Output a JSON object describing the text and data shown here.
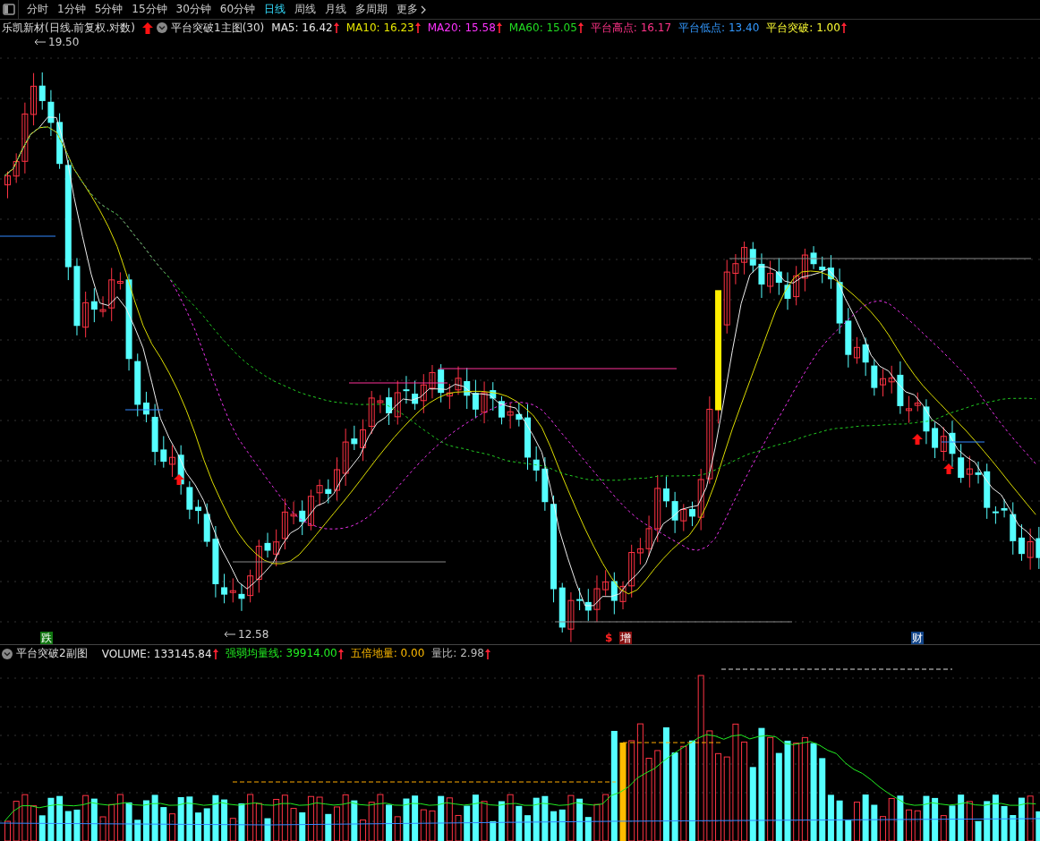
{
  "toolbar": {
    "tabs": [
      {
        "label": "分时",
        "selected": false
      },
      {
        "label": "1分钟",
        "selected": false
      },
      {
        "label": "5分钟",
        "selected": false
      },
      {
        "label": "15分钟",
        "selected": false
      },
      {
        "label": "30分钟",
        "selected": false
      },
      {
        "label": "60分钟",
        "selected": false
      },
      {
        "label": "日线",
        "selected": true
      },
      {
        "label": "周线",
        "selected": false
      },
      {
        "label": "月线",
        "selected": false
      },
      {
        "label": "多周期",
        "selected": false
      },
      {
        "label": "更多",
        "selected": false
      }
    ]
  },
  "main_legend": {
    "stock_title": "乐凯新材(日线.前复权.对数)",
    "indicator": "平台突破1主图(30)",
    "items": [
      {
        "label": "MA5:",
        "value": "16.42",
        "color": "#e6e6e6",
        "up_arrow": true
      },
      {
        "label": "MA10:",
        "value": "16.23",
        "color": "#e6e600",
        "up_arrow": true
      },
      {
        "label": "MA20:",
        "value": "15.58",
        "color": "#ff33ff",
        "up_arrow": true
      },
      {
        "label": "MA60:",
        "value": "15.05",
        "color": "#22dd22",
        "up_arrow": true
      },
      {
        "label": "平台高点:",
        "value": "16.17",
        "color": "#ff3388",
        "up_arrow": false
      },
      {
        "label": "平台低点:",
        "value": "13.40",
        "color": "#3399ff",
        "up_arrow": false
      },
      {
        "label": "平台突破:",
        "value": "1.00",
        "color": "#ffff33",
        "up_arrow": true
      }
    ]
  },
  "price_chart": {
    "high_label": "19.50",
    "low_label": "12.58",
    "markers": [
      {
        "kind": "badge",
        "text": "跌",
        "color": "#117711"
      },
      {
        "kind": "dollar",
        "text": "$",
        "color": "#ff2222"
      },
      {
        "kind": "badge",
        "text": "增",
        "color": "#881111"
      },
      {
        "kind": "badge",
        "text": "财",
        "color": "#114488"
      }
    ]
  },
  "sub_legend": {
    "indicator": "平台突破2副图",
    "items": [
      {
        "label": "VOLUME:",
        "value": "133145.84",
        "color": "#e6e6e6",
        "up_arrow": true
      },
      {
        "label": "强弱均量线:",
        "value": "39914.00",
        "color": "#22ee22",
        "up_arrow": true
      },
      {
        "label": "五倍地量:",
        "value": "0.00",
        "color": "#ffbb00",
        "up_arrow": false
      },
      {
        "label": "量比:",
        "value": "2.98",
        "color": "#bbbbbb",
        "up_arrow": true
      }
    ]
  }
}
